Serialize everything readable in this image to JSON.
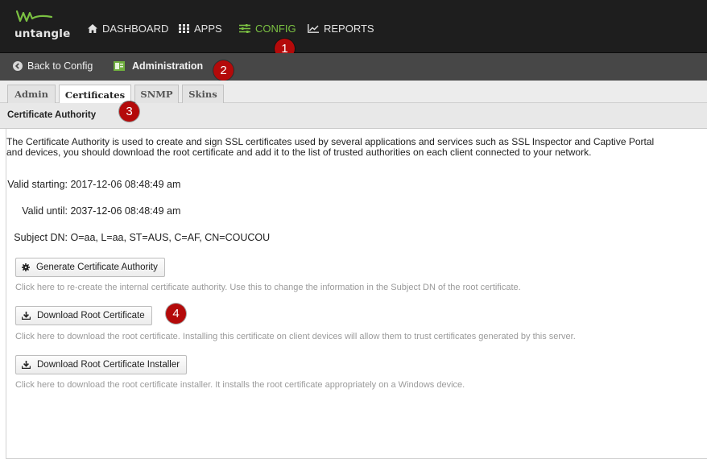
{
  "app": {
    "brand": "untangle",
    "brand_color": "#7bc142"
  },
  "nav": {
    "items": [
      {
        "label": "DASHBOARD",
        "icon": "home-icon"
      },
      {
        "label": "APPS",
        "icon": "grid-icon"
      },
      {
        "label": "CONFIG",
        "icon": "sliders-icon",
        "active": true
      },
      {
        "label": "REPORTS",
        "icon": "line-chart-icon"
      }
    ]
  },
  "subbar": {
    "back_label": "Back to Config",
    "crumb": "Administration"
  },
  "tabs": [
    {
      "label": "Admin"
    },
    {
      "label": "Certificates",
      "active": true
    },
    {
      "label": "SNMP"
    },
    {
      "label": "Skins"
    }
  ],
  "panel": {
    "title": "Certificate Authority",
    "intro_line1": "The Certificate Authority is used to create and sign SSL certificates used by several applications and services such as SSL Inspector and Captive Portal",
    "intro_line2": "and devices, you should download the root certificate and add it to the list of trusted authorities on each client connected to your network.",
    "fields": [
      {
        "label": "Valid starting:",
        "value": "2017-12-06 08:48:49 am"
      },
      {
        "label": "Valid until:",
        "value": "2037-12-06 08:48:49 am"
      },
      {
        "label": "Subject DN:",
        "value": "O=aa, L=aa, ST=AUS, C=AF, CN=COUCOU"
      }
    ],
    "actions": [
      {
        "label": "Generate Certificate Authority",
        "icon": "gear-icon",
        "help": "Click here to re-create the internal certificate authority. Use this to change the information in the Subject DN of the root certificate."
      },
      {
        "label": "Download Root Certificate",
        "icon": "download-icon",
        "help": "Click here to download the root certificate. Installing this certificate on client devices will allow them to trust certificates generated by this server."
      },
      {
        "label": "Download Root Certificate Installer",
        "icon": "download-icon",
        "help": "Click here to download the root certificate installer. It installs the root certificate appropriately on a Windows device."
      }
    ]
  },
  "markers": [
    "1",
    "2",
    "3",
    "4"
  ]
}
